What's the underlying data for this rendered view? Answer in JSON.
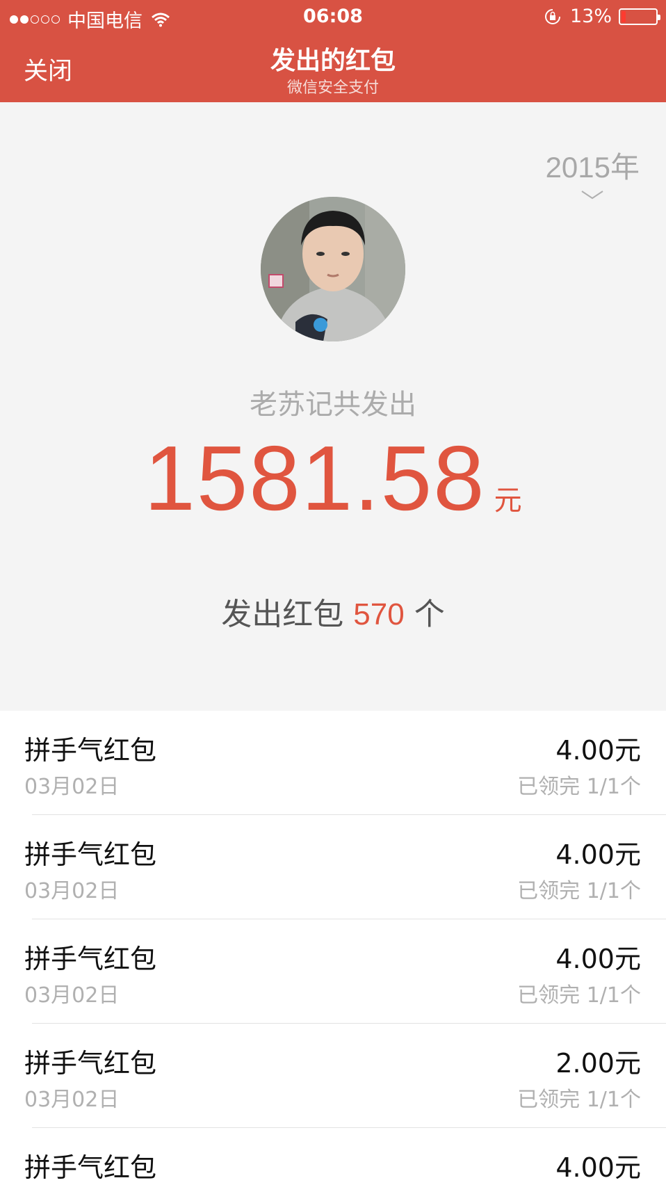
{
  "status_bar": {
    "carrier": "中国电信",
    "time": "06:08",
    "battery": "13%",
    "battery_level": 0.13,
    "signal_bars": 2
  },
  "header": {
    "close_label": "关闭",
    "title": "发出的红包",
    "subtitle": "微信安全支付"
  },
  "summary": {
    "year": "2015年",
    "sender_text": "老苏记共发出",
    "total_amount": "1581.58",
    "total_unit": "元",
    "count_prefix": "发出红包",
    "count": "570",
    "count_suffix": "个"
  },
  "records": [
    {
      "title": "拼手气红包",
      "date": "03月02日",
      "amount": "4.00元",
      "status": "已领完 1/1个"
    },
    {
      "title": "拼手气红包",
      "date": "03月02日",
      "amount": "4.00元",
      "status": "已领完 1/1个"
    },
    {
      "title": "拼手气红包",
      "date": "03月02日",
      "amount": "4.00元",
      "status": "已领完 1/1个"
    },
    {
      "title": "拼手气红包",
      "date": "03月02日",
      "amount": "2.00元",
      "status": "已领完 1/1个"
    },
    {
      "title": "拼手气红包",
      "date": "",
      "amount": "4.00元",
      "status": ""
    }
  ],
  "colors": {
    "header_bg": "#d85243",
    "accent": "#e0553f",
    "page_bg": "#f4f4f4"
  },
  "icons": [
    "wifi-icon",
    "rotation-lock-icon",
    "battery-icon",
    "chevron-down-icon"
  ]
}
